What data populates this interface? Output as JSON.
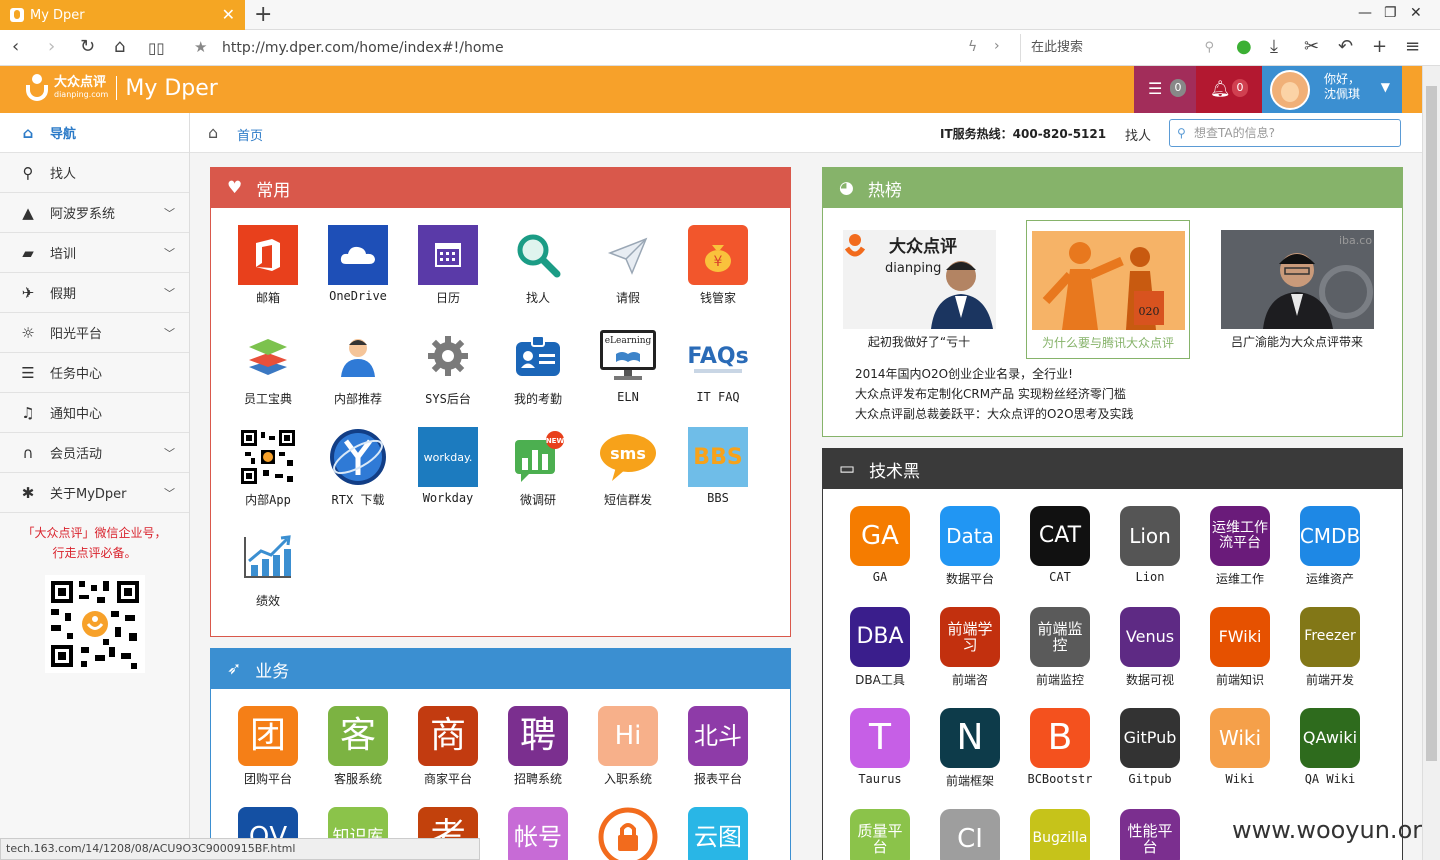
{
  "browser": {
    "tab_title": "My Dper",
    "new_tab": "+",
    "url": "http://my.dper.com/home/index#!/home",
    "search_placeholder": "在此搜索",
    "status_url": "tech.163.com/14/1208/08/ACU9O3C9000915BF.html"
  },
  "header": {
    "logo_cn": "大众点评",
    "logo_en": "dianping.com",
    "app_name": "My Dper",
    "messages_count": "0",
    "notifications_count": "0",
    "greeting": "你好，",
    "user_name": "沈佩琪"
  },
  "sidebar": {
    "items": [
      {
        "label": "导航",
        "icon": "home-icon"
      },
      {
        "label": "找人",
        "icon": "search-icon"
      },
      {
        "label": "阿波罗系统",
        "icon": "road-icon"
      },
      {
        "label": "培训",
        "icon": "book-icon"
      },
      {
        "label": "假期",
        "icon": "plane-icon"
      },
      {
        "label": "阳光平台",
        "icon": "sun-icon"
      },
      {
        "label": "任务中心",
        "icon": "list-icon"
      },
      {
        "label": "通知中心",
        "icon": "bell-icon"
      },
      {
        "label": "会员活动",
        "icon": "headphones-icon"
      },
      {
        "label": "关于MyDper",
        "icon": "bug-icon"
      }
    ],
    "promo_line1": "「大众点评」微信企业号，",
    "promo_line2": "行走点评必备。"
  },
  "breadcrumb": {
    "home": "首页",
    "hotline": "IT服务热线：400-820-5121",
    "find_people": "找人",
    "search_placeholder": "想查TA的信息?"
  },
  "panels": {
    "common": {
      "title": "常用",
      "tiles": [
        {
          "label": "邮箱",
          "color": "#e8401c"
        },
        {
          "label": "OneDrive",
          "color": "#1e4fb7"
        },
        {
          "label": "日历",
          "color": "#5a3aa8"
        },
        {
          "label": "找人",
          "color": "#ffffff"
        },
        {
          "label": "请假",
          "color": "#ffffff"
        },
        {
          "label": "钱管家",
          "color": "#f2562c"
        },
        {
          "label": "员工宝典",
          "color": "#ffffff"
        },
        {
          "label": "内部推荐",
          "color": "#ffffff"
        },
        {
          "label": "SYS后台",
          "color": "#ffffff"
        },
        {
          "label": "我的考勤",
          "color": "#ffffff"
        },
        {
          "label": "ELN",
          "color": "#ffffff"
        },
        {
          "label": "IT FAQ",
          "color": "#ffffff"
        },
        {
          "label": "内部App",
          "color": "#ffffff"
        },
        {
          "label": "RTX 下载",
          "color": "#ffffff"
        },
        {
          "label": "Workday",
          "color": "#1c7bbf"
        },
        {
          "label": "微调研",
          "color": "#ffffff"
        },
        {
          "label": "短信群发",
          "color": "#ffffff"
        },
        {
          "label": "BBS",
          "color": "#6fbde8"
        },
        {
          "label": "绩效",
          "color": "#ffffff"
        }
      ],
      "icon_text": {
        "workday": "workday.",
        "sms": "sms",
        "eln": "eLearning",
        "faq": "FAQs",
        "bbs": "BBS"
      }
    },
    "business": {
      "title": "业务",
      "tiles": [
        {
          "glyph": "团",
          "label": "团购平台",
          "color": "#f57f17"
        },
        {
          "glyph": "客",
          "label": "客服系统",
          "color": "#7cb342"
        },
        {
          "glyph": "商",
          "label": "商家平台",
          "color": "#c23b10"
        },
        {
          "glyph": "聘",
          "label": "招聘系统",
          "color": "#7b2f8f"
        },
        {
          "glyph": "Hi",
          "label": "入职系统",
          "color": "#f7b08a"
        },
        {
          "glyph": "北斗",
          "label": "报表平台",
          "color": "#8e3ba8"
        },
        {
          "glyph": "QV",
          "label": "",
          "color": "#1450a3"
        },
        {
          "glyph": "知识库",
          "label": "",
          "color": "#8bc34a"
        },
        {
          "glyph": "考",
          "label": "",
          "color": "#c2410c"
        },
        {
          "glyph": "帐号",
          "label": "",
          "color": "#c76bd6"
        },
        {
          "glyph": "",
          "label": "",
          "color": "#ffffff"
        },
        {
          "glyph": "云图",
          "label": "",
          "color": "#29b6e6"
        }
      ]
    },
    "hot": {
      "title": "热榜",
      "cards": [
        {
          "caption": "起初我做好了“亏十"
        },
        {
          "caption": "为什么要与腾讯大众点评"
        },
        {
          "caption": "吕广渝能为大众点评带来"
        }
      ],
      "photo_text": {
        "logo_cn": "大众点评",
        "logo_en": "dianping",
        "badge": "020",
        "bg": "iba.co"
      },
      "news": [
        "2014年国内O2O创业企业名录，全行业!",
        "大众点评发布定制化CRM产品 实现粉丝经济零门槛",
        "大众点评副总裁姜跃平：大众点评的O2O思考及实践"
      ]
    },
    "tech": {
      "title": "技术黑",
      "tiles": [
        {
          "glyph": "GA",
          "label": "GA",
          "color": "#f57c00"
        },
        {
          "glyph": "Data",
          "label": "数据平台",
          "color": "#2196f3"
        },
        {
          "glyph": "CAT",
          "label": "CAT",
          "color": "#111111"
        },
        {
          "glyph": "Lion",
          "label": "Lion",
          "color": "#555555"
        },
        {
          "glyph": "运维工作流平台",
          "label": "运维工作",
          "color": "#6a1b7a"
        },
        {
          "glyph": "CMDB",
          "label": "运维资产",
          "color": "#1e88e5"
        },
        {
          "glyph": "DBA",
          "label": "DBA工具",
          "color": "#3a1e8c"
        },
        {
          "glyph": "前端学习",
          "label": "前端咨",
          "color": "#c2300e"
        },
        {
          "glyph": "前端监控",
          "label": "前端监控",
          "color": "#5a5a5a"
        },
        {
          "glyph": "Venus",
          "label": "数据可视",
          "color": "#5e2a84"
        },
        {
          "glyph": "FWiki",
          "label": "前端知识",
          "color": "#e65100"
        },
        {
          "glyph": "Freezer",
          "label": "前端开发",
          "color": "#827717"
        },
        {
          "glyph": "T",
          "label": "Taurus",
          "color": "#c65fe6"
        },
        {
          "glyph": "N",
          "label": "前端框架",
          "color": "#0d3b4a"
        },
        {
          "glyph": "B",
          "label": "BCBootstr",
          "color": "#f4511e"
        },
        {
          "glyph": "GitPub",
          "label": "Gitpub",
          "color": "#333333"
        },
        {
          "glyph": "Wiki",
          "label": "Wiki",
          "color": "#f5a04a"
        },
        {
          "glyph": "QAwiki",
          "label": "QA Wiki",
          "color": "#2e6b1d"
        },
        {
          "glyph": "质量平台",
          "label": "",
          "color": "#8bc34a"
        },
        {
          "glyph": "CI",
          "label": "",
          "color": "#9e9e9e"
        },
        {
          "glyph": "Bugzilla",
          "label": "",
          "color": "#c6c31a"
        },
        {
          "glyph": "性能平台",
          "label": "",
          "color": "#7b2f8f"
        }
      ]
    }
  },
  "watermark": "www.wooyun.org"
}
